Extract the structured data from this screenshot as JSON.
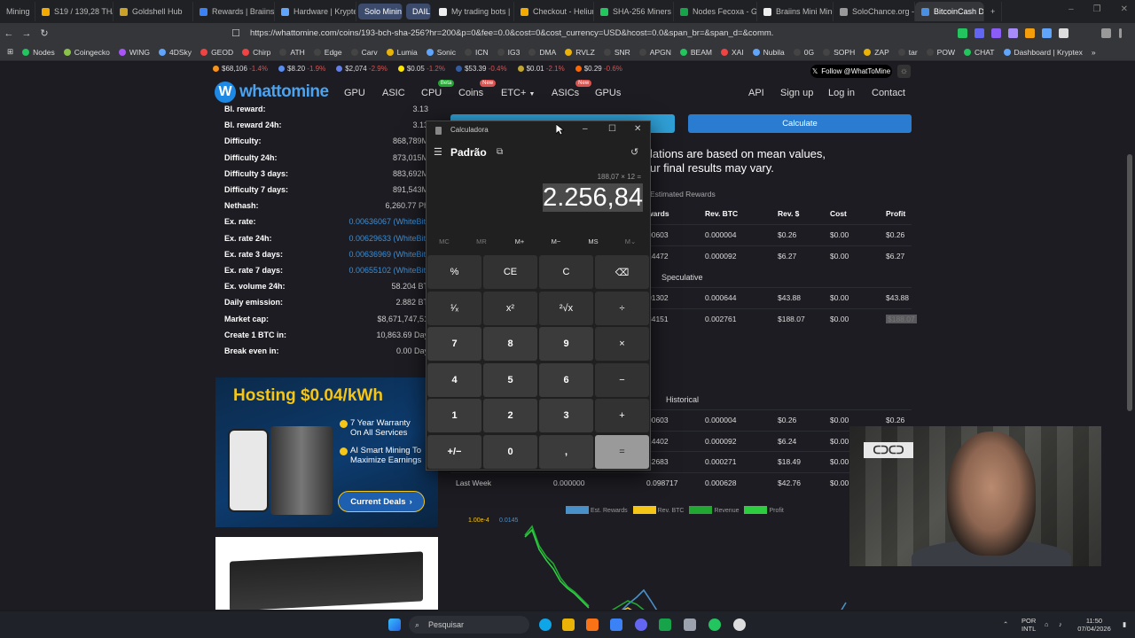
{
  "browser": {
    "tabs": [
      {
        "label": "Mining",
        "color": "#888"
      },
      {
        "label": "S19 / 139,28 TH/s",
        "color": "#f2a900"
      },
      {
        "label": "Goldshell Hub",
        "color": "#c9a227"
      },
      {
        "label": "Rewards | Braiins",
        "color": "#3b82f6"
      },
      {
        "label": "Hardware | Krypte",
        "color": "#60a5fa"
      },
      {
        "label": "Solo Mining",
        "color": "#3c4a6b"
      },
      {
        "label": "DAILY",
        "color": "#3c4a6b"
      },
      {
        "label": "My trading bots |",
        "color": "#eee"
      },
      {
        "label": "Checkout - Helium",
        "color": "#f2a900"
      },
      {
        "label": "SHA-256 Miners",
        "color": "#22c55e"
      },
      {
        "label": "Nodes Fecoxa - G",
        "color": "#16a34a"
      },
      {
        "label": "Braiins Mini Mine",
        "color": "#eee"
      },
      {
        "label": "SoloChance.org -",
        "color": "#999"
      },
      {
        "label": "BitcoinCash D",
        "color": "#4a90e2"
      }
    ],
    "url": "https://whattomine.com/coins/193-bch-sha-256?hr=200&p=0&fee=0.0&cost=0&cost_currency=USD&hcost=0.0&span_br=&span_d=&comm...",
    "bookmarks": [
      {
        "label": "Nodes",
        "color": "#22c55e"
      },
      {
        "label": "Coingecko",
        "color": "#8bc34a"
      },
      {
        "label": "WING",
        "color": "#a855f7"
      },
      {
        "label": "4DSky",
        "color": "#60a5fa"
      },
      {
        "label": "GEOD",
        "color": "#ef4444"
      },
      {
        "label": "Chirp",
        "color": "#ef4444"
      },
      {
        "label": "ATH",
        "color": "#444"
      },
      {
        "label": "Edge",
        "color": "#444"
      },
      {
        "label": "Carv",
        "color": "#444"
      },
      {
        "label": "Lumia",
        "color": "#eab308"
      },
      {
        "label": "Sonic",
        "color": "#60a5fa"
      },
      {
        "label": "ICN",
        "color": "#444"
      },
      {
        "label": "IG3",
        "color": "#444"
      },
      {
        "label": "DMA",
        "color": "#444"
      },
      {
        "label": "RVLZ",
        "color": "#eab308"
      },
      {
        "label": "SNR",
        "color": "#444"
      },
      {
        "label": "APGN",
        "color": "#444"
      },
      {
        "label": "BEAM",
        "color": "#22c55e"
      },
      {
        "label": "XAI",
        "color": "#ef4444"
      },
      {
        "label": "Nubila",
        "color": "#60a5fa"
      },
      {
        "label": "0G",
        "color": "#444"
      },
      {
        "label": "SOPH",
        "color": "#444"
      },
      {
        "label": "ZAP",
        "color": "#eab308"
      },
      {
        "label": "tar",
        "color": "#444"
      },
      {
        "label": "POW",
        "color": "#444"
      },
      {
        "label": "CHAT",
        "color": "#22c55e"
      },
      {
        "label": "Dashboard | Kryptex",
        "color": "#60a5fa"
      }
    ]
  },
  "ticker": [
    {
      "price": "$68,106",
      "change": "-1.4%",
      "color": "#f7931a"
    },
    {
      "price": "$8.20",
      "change": "-1.9%",
      "color": "#5b8def"
    },
    {
      "price": "$2,074",
      "change": "-2.9%",
      "color": "#627eea"
    },
    {
      "price": "$0.05",
      "change": "-1.2%",
      "color": "#ffe600"
    },
    {
      "price": "$53.39",
      "change": "-0.4%",
      "color": "#345d9d"
    },
    {
      "price": "$0.01",
      "change": "-2.1%",
      "color": "#c2a633"
    },
    {
      "price": "$0.29",
      "change": "-0.6%",
      "color": "#ff6600"
    }
  ],
  "site": {
    "logo": "whattomine",
    "nav": [
      "GPU",
      "ASIC",
      "CPU",
      "Coins",
      "ETC+",
      "ASICs",
      "GPUs"
    ],
    "nav_badges": {
      "cpu": "Beta",
      "coins": "New",
      "asics": "New"
    },
    "nav_right": [
      "API",
      "Sign up",
      "Log in",
      "Contact"
    ],
    "follow": "Follow @WhatToMine"
  },
  "stats": [
    {
      "label": "Bl. reward:",
      "value": "3.13",
      "link": false
    },
    {
      "label": "Bl. reward 24h:",
      "value": "3.13",
      "link": false
    },
    {
      "label": "Difficulty:",
      "value": "868,789M",
      "link": false
    },
    {
      "label": "Difficulty 24h:",
      "value": "873,015M",
      "link": false
    },
    {
      "label": "Difficulty 3 days:",
      "value": "883,692M",
      "link": false
    },
    {
      "label": "Difficulty 7 days:",
      "value": "891,543M",
      "link": false
    },
    {
      "label": "Nethash:",
      "value": "6,260.77 Ph",
      "link": false
    },
    {
      "label": "Ex. rate:",
      "value": "0.00636067 (WhiteBit)",
      "link": true
    },
    {
      "label": "Ex. rate 24h:",
      "value": "0.00629633 (WhiteBit)",
      "link": true
    },
    {
      "label": "Ex. rate 3 days:",
      "value": "0.00636969 (WhiteBit)",
      "link": true
    },
    {
      "label": "Ex. rate 7 days:",
      "value": "0.00655102 (WhiteBit)",
      "link": true
    },
    {
      "label": "Ex. volume 24h:",
      "value": "58.204 BT",
      "link": false
    },
    {
      "label": "Daily emission:",
      "value": "2.882 BT",
      "link": false
    },
    {
      "label": "Market cap:",
      "value": "$8,671,747,51",
      "link": false
    },
    {
      "label": "Create 1 BTC in:",
      "value": "10,863.69 Day",
      "link": false
    },
    {
      "label": "Break even in:",
      "value": "0.00 Day",
      "link": false
    }
  ],
  "ads": {
    "hosting_title": "Hosting $0.04/kWh",
    "features": [
      "7 Year Warranty On All Services",
      "AI Smart Mining To Maximize Earnings"
    ],
    "cta": "Current Deals"
  },
  "main": {
    "calculate": "Calculate",
    "notice_line1": "lations are based on mean values,",
    "notice_line2": "ur final results may vary.",
    "estimated": "Estimated Rewards",
    "speculative": "Speculative",
    "historical": "Historical",
    "headers": [
      "wards",
      "Rev. BTC",
      "Rev. $",
      "Cost",
      "Profit"
    ],
    "est_rows": [
      [
        "00603",
        "0.000004",
        "$0.26",
        "$0.00",
        "$0.26"
      ],
      [
        "14472",
        "0.000092",
        "$6.27",
        "$0.00",
        "$6.27"
      ]
    ],
    "spec_rows": [
      [
        "01302",
        "0.000644",
        "$43.88",
        "$0.00",
        "$43.88"
      ],
      [
        "34151",
        "0.002761",
        "$188.07",
        "$0.00",
        "$188.07"
      ]
    ],
    "hist_rows": [
      [
        "00603",
        "0.000004",
        "$0.26",
        "$0.00",
        "$0.26"
      ],
      [
        "14402",
        "0.000092",
        "$6.24",
        "$0.00",
        "$6.24"
      ],
      [
        "42683",
        "0.000271",
        "$18.49",
        "$0.00",
        "$18.49"
      ]
    ],
    "last_week": [
      "Last Week",
      "0.000000",
      "0.098717",
      "0.000628",
      "$42.76",
      "$0.00",
      "$42.76"
    ],
    "legend": [
      "Est. Rewards",
      "Rev. BTC",
      "Revenue",
      "Profit"
    ],
    "legend_colors": [
      "#4a90c8",
      "#f5c518",
      "#22a832",
      "#2ecc40"
    ],
    "axis_left": [
      "1.00e-4",
      "9.5e-5",
      "BTC"
    ],
    "axis_left2": [
      "0.0145",
      "0.0140"
    ],
    "axis_right": [
      "6.2"
    ]
  },
  "calculator": {
    "title": "Calculadora",
    "mode": "Padrão",
    "expression": "188,07 × 12 =",
    "result": "2.256,84",
    "memory": [
      "MC",
      "MR",
      "M+",
      "M−",
      "MS",
      "M⌄"
    ],
    "keys": [
      "%",
      "CE",
      "C",
      "⌫",
      "¹⁄ₓ",
      "x²",
      "²√x",
      "÷",
      "7",
      "8",
      "9",
      "×",
      "4",
      "5",
      "6",
      "−",
      "1",
      "2",
      "3",
      "+",
      "+/−",
      "0",
      ",",
      "="
    ]
  },
  "webcam": {
    "sign": "ᑕᑐᑕᑐ"
  },
  "taskbar": {
    "search": "Pesquisar",
    "lang1": "POR",
    "lang2": "INTL",
    "time": "11:50",
    "date": "07/04/2026"
  }
}
